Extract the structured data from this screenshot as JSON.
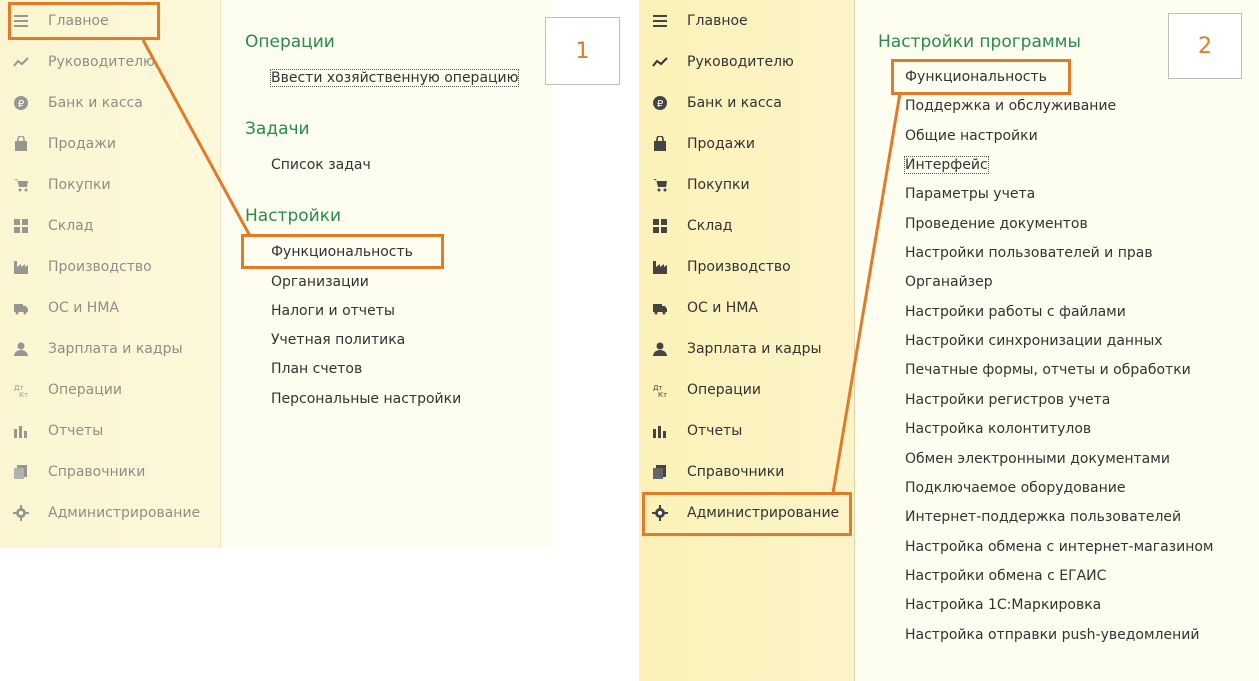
{
  "panel1": {
    "number": "1",
    "sidebar": [
      {
        "label": "Главное",
        "icon": "menu-icon"
      },
      {
        "label": "Руководителю",
        "icon": "trend-icon"
      },
      {
        "label": "Банк и касса",
        "icon": "ruble-icon"
      },
      {
        "label": "Продажи",
        "icon": "bag-icon"
      },
      {
        "label": "Покупки",
        "icon": "cart-icon"
      },
      {
        "label": "Склад",
        "icon": "grid-icon"
      },
      {
        "label": "Производство",
        "icon": "factory-icon"
      },
      {
        "label": "ОС и НМА",
        "icon": "truck-icon"
      },
      {
        "label": "Зарплата и кадры",
        "icon": "person-icon"
      },
      {
        "label": "Операции",
        "icon": "dt-kt-icon"
      },
      {
        "label": "Отчеты",
        "icon": "bar-chart-icon"
      },
      {
        "label": "Справочники",
        "icon": "books-icon"
      },
      {
        "label": "Администрирование",
        "icon": "gear-icon"
      }
    ],
    "sections": [
      {
        "title": "Операции",
        "links": [
          "Ввести хозяйственную операцию"
        ]
      },
      {
        "title": "Задачи",
        "links": [
          "Список задач"
        ]
      },
      {
        "title": "Настройки",
        "links": [
          "Функциональность",
          "Организации",
          "Налоги и отчеты",
          "Учетная политика",
          "План счетов",
          "Персональные настройки"
        ]
      }
    ]
  },
  "panel2": {
    "number": "2",
    "sidebar": [
      {
        "label": "Главное",
        "icon": "menu-icon"
      },
      {
        "label": "Руководителю",
        "icon": "trend-icon"
      },
      {
        "label": "Банк и касса",
        "icon": "ruble-icon"
      },
      {
        "label": "Продажи",
        "icon": "bag-icon"
      },
      {
        "label": "Покупки",
        "icon": "cart-icon"
      },
      {
        "label": "Склад",
        "icon": "grid-icon"
      },
      {
        "label": "Производство",
        "icon": "factory-icon"
      },
      {
        "label": "ОС и НМА",
        "icon": "truck-icon"
      },
      {
        "label": "Зарплата и кадры",
        "icon": "person-icon"
      },
      {
        "label": "Операции",
        "icon": "dt-kt-icon"
      },
      {
        "label": "Отчеты",
        "icon": "bar-chart-icon"
      },
      {
        "label": "Справочники",
        "icon": "books-icon"
      },
      {
        "label": "Администрирование",
        "icon": "gear-icon"
      }
    ],
    "section_title": "Настройки программы",
    "links": [
      "Функциональность",
      "Поддержка и обслуживание",
      "Общие настройки",
      "Интерфейс",
      "Параметры учета",
      "Проведение документов",
      "Настройки пользователей и прав",
      "Органайзер",
      "Настройки работы с файлами",
      "Настройки синхронизации данных",
      "Печатные формы, отчеты и обработки",
      "Настройки регистров учета",
      "Настройка колонтитулов",
      "Обмен электронными документами",
      "Подключаемое оборудование",
      "Интернет-поддержка пользователей",
      "Настройка обмена с интернет-магазином",
      "Настройки обмена с ЕГАИС",
      "Настройка 1С:Маркировка",
      "Настройка отправки push-уведомлений"
    ]
  },
  "colors": {
    "accent": "#e07b2a",
    "section_title": "#2b8a4c",
    "sidebar_bg": "#fbf1b8"
  }
}
